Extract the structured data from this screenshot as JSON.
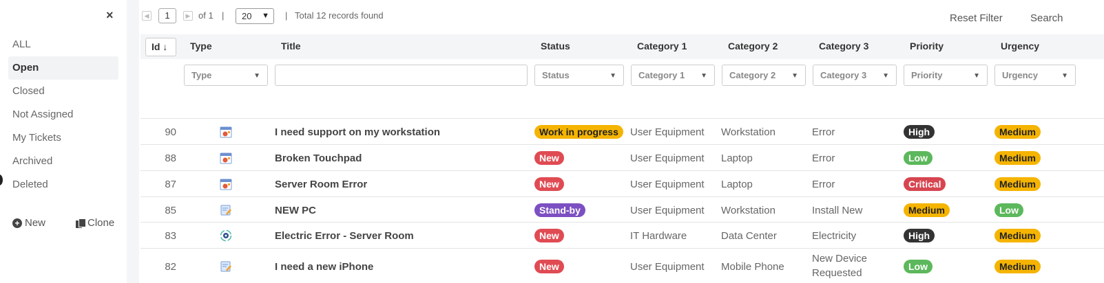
{
  "sidebar": {
    "close": "×",
    "items": [
      {
        "label": "ALL",
        "active": false
      },
      {
        "label": "Open",
        "active": true
      },
      {
        "label": "Closed",
        "active": false
      },
      {
        "label": "Not Assigned",
        "active": false
      },
      {
        "label": "My Tickets",
        "active": false
      },
      {
        "label": "Archived",
        "active": false
      },
      {
        "label": "Deleted",
        "active": false
      }
    ],
    "new_label": "New",
    "clone_label": "Clone"
  },
  "toolbar": {
    "page": "1",
    "of_label": "of 1",
    "sep1": "|",
    "page_size": "20",
    "sep2": "|",
    "total": "Total 12 records found",
    "reset_filter": "Reset Filter",
    "search": "Search"
  },
  "columns": {
    "id": "Id",
    "type": "Type",
    "title": "Title",
    "status": "Status",
    "category1": "Category 1",
    "category2": "Category 2",
    "category3": "Category 3",
    "priority": "Priority",
    "urgency": "Urgency"
  },
  "filters": {
    "type": "Type",
    "status": "Status",
    "category1": "Category 1",
    "category2": "Category 2",
    "category3": "Category 3",
    "priority": "Priority",
    "urgency": "Urgency"
  },
  "rows": [
    {
      "id": "90",
      "icon": "calendar-bug-icon",
      "title": "I need support on my workstation",
      "status": "Work in progress",
      "status_color": "#f5b400",
      "cat1": "User Equipment",
      "cat2": "Workstation",
      "cat3": "Error",
      "cat3b": "",
      "priority": "High",
      "priority_color": "#333333",
      "urgency": "Medium",
      "urgency_color": "#f5b400"
    },
    {
      "id": "88",
      "icon": "calendar-bug-icon",
      "title": "Broken Touchpad",
      "status": "New",
      "status_color": "#e04b53",
      "cat1": "User Equipment",
      "cat2": "Laptop",
      "cat3": "Error",
      "cat3b": "",
      "priority": "Low",
      "priority_color": "#5cb85c",
      "urgency": "Medium",
      "urgency_color": "#f5b400"
    },
    {
      "id": "87",
      "icon": "calendar-bug-icon",
      "title": "Server Room Error",
      "status": "New",
      "status_color": "#e04b53",
      "cat1": "User Equipment",
      "cat2": "Laptop",
      "cat3": "Error",
      "cat3b": "",
      "priority": "Critical",
      "priority_color": "#d64550",
      "urgency": "Medium",
      "urgency_color": "#f5b400"
    },
    {
      "id": "85",
      "icon": "note-pencil-icon",
      "title": "NEW PC",
      "status": "Stand-by",
      "status_color": "#7c4fc2",
      "cat1": "User Equipment",
      "cat2": "Workstation",
      "cat3": "Install New",
      "cat3b": "",
      "priority": "Medium",
      "priority_color": "#f5b400",
      "urgency": "Low",
      "urgency_color": "#5cb85c"
    },
    {
      "id": "83",
      "icon": "gear-cycle-icon",
      "title": "Electric Error - Server Room",
      "status": "New",
      "status_color": "#e04b53",
      "cat1": "IT Hardware",
      "cat2": "Data Center",
      "cat3": "Electricity",
      "cat3b": "",
      "priority": "High",
      "priority_color": "#333333",
      "urgency": "Medium",
      "urgency_color": "#f5b400"
    },
    {
      "id": "82",
      "icon": "note-pencil-icon",
      "title": "I need a new iPhone",
      "status": "New",
      "status_color": "#e04b53",
      "cat1": "User Equipment",
      "cat2": "Mobile Phone",
      "cat3": "New Device",
      "cat3b": "Requested",
      "priority": "Low",
      "priority_color": "#5cb85c",
      "urgency": "Medium",
      "urgency_color": "#f5b400"
    }
  ]
}
